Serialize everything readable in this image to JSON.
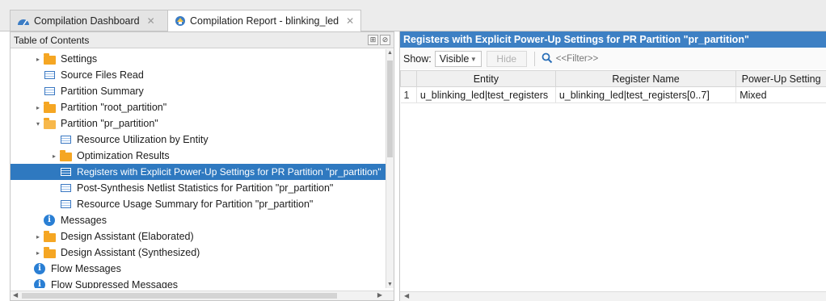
{
  "tabs": [
    {
      "label": "Compilation Dashboard",
      "icon": "dashboard-icon"
    },
    {
      "label": "Compilation Report - blinking_led",
      "icon": "report-icon"
    }
  ],
  "toc": {
    "title": "Table of Contents",
    "items": [
      {
        "label": "Settings",
        "icon": "folder-icon",
        "arrow": "▸"
      },
      {
        "label": "Source Files Read",
        "icon": "table-icon",
        "arrow": ""
      },
      {
        "label": "Partition Summary",
        "icon": "table-icon",
        "arrow": ""
      },
      {
        "label": "Partition \"root_partition\"",
        "icon": "folder-icon",
        "arrow": "▸"
      },
      {
        "label": "Partition \"pr_partition\"",
        "icon": "open-folder-icon",
        "arrow": "▾"
      },
      {
        "label": "Resource Utilization by Entity",
        "icon": "table-icon",
        "arrow": ""
      },
      {
        "label": "Optimization Results",
        "icon": "folder-icon",
        "arrow": "▸"
      },
      {
        "label": "Registers with Explicit Power-Up Settings for PR Partition \"pr_partition\"",
        "icon": "table-icon",
        "arrow": ""
      },
      {
        "label": "Post-Synthesis Netlist Statistics for Partition \"pr_partition\"",
        "icon": "table-icon",
        "arrow": ""
      },
      {
        "label": "Resource Usage Summary for Partition \"pr_partition\"",
        "icon": "table-icon",
        "arrow": ""
      },
      {
        "label": "Messages",
        "icon": "info-icon",
        "arrow": ""
      },
      {
        "label": "Design Assistant (Elaborated)",
        "icon": "folder-icon",
        "arrow": "▸"
      },
      {
        "label": "Design Assistant (Synthesized)",
        "icon": "folder-icon",
        "arrow": "▸"
      },
      {
        "label": "Flow Messages",
        "icon": "info-icon",
        "arrow": ""
      },
      {
        "label": "Flow Suppressed Messages",
        "icon": "info-icon",
        "arrow": ""
      }
    ]
  },
  "report": {
    "title": "Registers with Explicit Power-Up Settings for PR Partition \"pr_partition\"",
    "show_label": "Show:",
    "show_value": "Visible",
    "hide_label": "Hide",
    "filter_placeholder": "<<Filter>>",
    "columns": [
      "",
      "Entity",
      "Register Name",
      "Power-Up Setting"
    ],
    "rows": [
      {
        "num": "1",
        "entity": "u_blinking_led|test_registers",
        "register": "u_blinking_led|test_registers[0..7]",
        "setting": "Mixed"
      }
    ]
  },
  "colors": {
    "selection": "#2f79c0",
    "header_blue": "#3d80c4",
    "folder": "#f5a623"
  }
}
